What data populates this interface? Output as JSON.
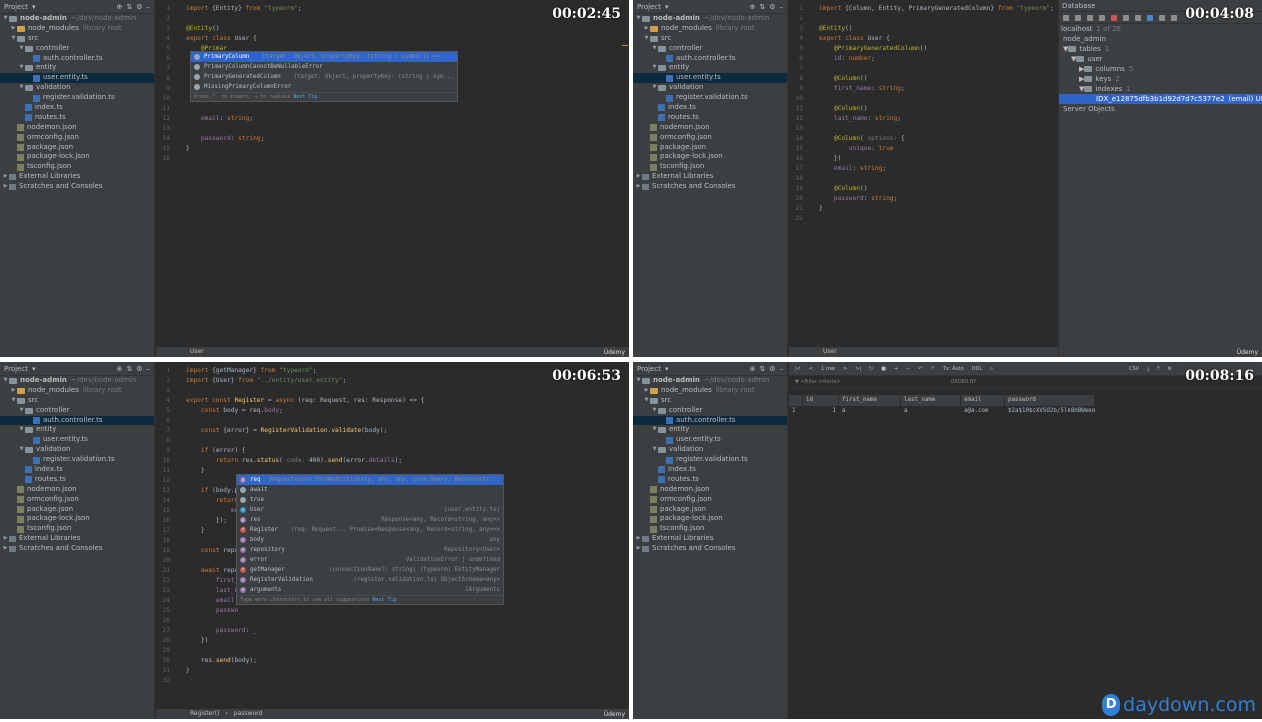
{
  "colors": {
    "keyword": "#cc7832",
    "string": "#6a8759",
    "annotation": "#bbb529",
    "selection": "#2f65ca",
    "watermark": "#2f7fd6"
  },
  "tree_common": {
    "header": "Project",
    "root": "node-admin",
    "root_path": "~/dev/node-admin",
    "node_modules": "node_modules",
    "node_modules_note": "library root",
    "src": "src",
    "controller": "controller",
    "auth_controller": "auth.controller.ts",
    "entity": "entity",
    "user_entity": "user.entity.ts",
    "validation": "validation",
    "register_validation": "register.validation.ts",
    "index": "index.ts",
    "routes": "routes.ts",
    "nodemon": "nodemon.json",
    "ormconfig": "ormconfig.json",
    "package": "package.json",
    "package_lock": "package-lock.json",
    "tsconfig": "tsconfig.json",
    "external": "External Libraries",
    "scratches": "Scratches and Consoles"
  },
  "q1": {
    "timer": "00:02:45",
    "status": "User",
    "brand": "Üdemy",
    "lines": [
      {
        "n": "1",
        "t": [
          [
            "kw",
            "import "
          ],
          [
            "plain",
            "{Entity} "
          ],
          [
            "kw",
            "from "
          ],
          [
            "str",
            "\"typeorm\""
          ],
          [
            "plain",
            ";"
          ]
        ]
      },
      {
        "n": "2",
        "t": []
      },
      {
        "n": "3",
        "t": [
          [
            "ann",
            "@Entity"
          ],
          [
            "plain",
            "()"
          ]
        ]
      },
      {
        "n": "4",
        "t": [
          [
            "kw",
            "export class "
          ],
          [
            "plain",
            "User {"
          ]
        ]
      },
      {
        "n": "5",
        "t": [
          [
            "plain",
            "    "
          ],
          [
            "ann",
            "@Primar"
          ]
        ]
      },
      {
        "n": "6",
        "t": []
      },
      {
        "n": "7",
        "t": []
      },
      {
        "n": "8",
        "t": []
      },
      {
        "n": "9",
        "t": []
      },
      {
        "n": "10",
        "t": []
      },
      {
        "n": "11",
        "t": []
      },
      {
        "n": "12",
        "t": [
          [
            "plain",
            "    "
          ],
          [
            "prop",
            "email"
          ],
          [
            "plain",
            ": "
          ],
          [
            "kw",
            "string"
          ],
          [
            "plain",
            ";"
          ]
        ]
      },
      {
        "n": "13",
        "t": []
      },
      {
        "n": "14",
        "t": [
          [
            "plain",
            "    "
          ],
          [
            "prop",
            "password"
          ],
          [
            "plain",
            ": "
          ],
          [
            "kw",
            "string"
          ],
          [
            "plain",
            ";"
          ]
        ]
      },
      {
        "n": "15",
        "t": [
          [
            "plain",
            "}"
          ]
        ]
      },
      {
        "n": "16",
        "t": []
      }
    ],
    "popup": {
      "items": [
        {
          "label": "PrimaryColumn",
          "right": "(target: Object, propertyKey: (string | symbol)) => ...",
          "sel": true
        },
        {
          "label": "PrimaryColumnCannotBeNullableError",
          "right": "",
          "sel": false
        },
        {
          "label": "PrimaryGeneratedColumn",
          "right": "(target: Object, propertyKey: (string | sym...",
          "sel": false
        },
        {
          "label": "MissingPrimaryColumnError",
          "right": "",
          "sel": false
        }
      ],
      "foot": "Press ^. to insert, → to replace",
      "tip": "Next Tip"
    }
  },
  "q2": {
    "timer": "00:04:08",
    "status": "User",
    "brand": "Üdemy",
    "lines": [
      {
        "n": "1",
        "t": [
          [
            "kw",
            "import "
          ],
          [
            "plain",
            "{Column, Entity, PrimaryGeneratedColumn} "
          ],
          [
            "kw",
            "from "
          ],
          [
            "str",
            "\"typeorm\""
          ],
          [
            "plain",
            ";"
          ]
        ]
      },
      {
        "n": "2",
        "t": []
      },
      {
        "n": "3",
        "t": [
          [
            "ann",
            "@Entity"
          ],
          [
            "plain",
            "()"
          ]
        ]
      },
      {
        "n": "4",
        "t": [
          [
            "kw",
            "export class "
          ],
          [
            "plain",
            "User {"
          ]
        ]
      },
      {
        "n": "5",
        "t": [
          [
            "plain",
            "    "
          ],
          [
            "ann",
            "@PrimaryGeneratedColumn"
          ],
          [
            "plain",
            "()"
          ]
        ]
      },
      {
        "n": "6",
        "t": [
          [
            "plain",
            "    "
          ],
          [
            "prop",
            "id"
          ],
          [
            "plain",
            ": "
          ],
          [
            "kw",
            "number"
          ],
          [
            "plain",
            ";"
          ]
        ]
      },
      {
        "n": "7",
        "t": []
      },
      {
        "n": "8",
        "t": [
          [
            "plain",
            "    "
          ],
          [
            "ann",
            "@Column"
          ],
          [
            "plain",
            "()"
          ]
        ]
      },
      {
        "n": "9",
        "t": [
          [
            "plain",
            "    "
          ],
          [
            "prop",
            "first_name"
          ],
          [
            "plain",
            ": "
          ],
          [
            "kw",
            "string"
          ],
          [
            "plain",
            ";"
          ]
        ]
      },
      {
        "n": "10",
        "t": []
      },
      {
        "n": "11",
        "t": [
          [
            "plain",
            "    "
          ],
          [
            "ann",
            "@Column"
          ],
          [
            "plain",
            "()"
          ]
        ]
      },
      {
        "n": "12",
        "t": [
          [
            "plain",
            "    "
          ],
          [
            "prop",
            "last_name"
          ],
          [
            "plain",
            ": "
          ],
          [
            "kw",
            "string"
          ],
          [
            "plain",
            ";"
          ]
        ]
      },
      {
        "n": "13",
        "t": []
      },
      {
        "n": "14",
        "t": [
          [
            "plain",
            "    "
          ],
          [
            "ann",
            "@Column"
          ],
          [
            "plain",
            "( "
          ],
          [
            "hint",
            "options: "
          ],
          [
            "plain",
            "{"
          ]
        ]
      },
      {
        "n": "15",
        "t": [
          [
            "plain",
            "        "
          ],
          [
            "prop",
            "unique"
          ],
          [
            "plain",
            ": "
          ],
          [
            "kw",
            "true"
          ]
        ]
      },
      {
        "n": "16",
        "t": [
          [
            "plain",
            "    })"
          ]
        ]
      },
      {
        "n": "17",
        "t": [
          [
            "plain",
            "    "
          ],
          [
            "prop",
            "email"
          ],
          [
            "plain",
            ": "
          ],
          [
            "kw",
            "string"
          ],
          [
            "plain",
            ";"
          ]
        ]
      },
      {
        "n": "18",
        "t": []
      },
      {
        "n": "19",
        "t": [
          [
            "plain",
            "    "
          ],
          [
            "ann",
            "@Column"
          ],
          [
            "plain",
            "()"
          ]
        ]
      },
      {
        "n": "20",
        "t": [
          [
            "plain",
            "    "
          ],
          [
            "prop",
            "password"
          ],
          [
            "plain",
            ": "
          ],
          [
            "kw",
            "string"
          ],
          [
            "plain",
            ";"
          ]
        ]
      },
      {
        "n": "21",
        "t": [
          [
            "plain",
            "}"
          ]
        ]
      },
      {
        "n": "22",
        "t": []
      }
    ],
    "db": {
      "title": "Database",
      "host": "localhost",
      "host_note": "1 of 26",
      "schema": "node_admin",
      "tables": "tables",
      "tables_count": "1",
      "user": "user",
      "columns": "columns",
      "columns_count": "5",
      "keys": "keys",
      "keys_count": "2",
      "indexes": "indexes",
      "indexes_count": "1",
      "index_name": "IDX_e12875dfb3b1d92d7d7c5377e2",
      "index_desc": "(email) UNIQUE",
      "server_objects": "Server Objects"
    }
  },
  "q3": {
    "timer": "00:06:53",
    "status": "Register()",
    "status2": "password",
    "brand": "Üdemy",
    "lines": [
      {
        "n": "1",
        "t": [
          [
            "kw",
            "import "
          ],
          [
            "plain",
            "{getManager} "
          ],
          [
            "kw",
            "from "
          ],
          [
            "str",
            "\"typeorm\""
          ],
          [
            "plain",
            ";"
          ]
        ]
      },
      {
        "n": "2",
        "t": [
          [
            "kw",
            "import "
          ],
          [
            "plain",
            "{User} "
          ],
          [
            "kw",
            "from "
          ],
          [
            "str",
            "\"../entity/user.entity\""
          ],
          [
            "plain",
            ";"
          ]
        ]
      },
      {
        "n": "3",
        "t": []
      },
      {
        "n": "4",
        "t": [
          [
            "kw",
            "export const "
          ],
          [
            "fn",
            "Register"
          ],
          [
            "plain",
            " = "
          ],
          [
            "kw",
            "async "
          ],
          [
            "plain",
            "(req: Request, res: Response) => {"
          ]
        ]
      },
      {
        "n": "5",
        "t": [
          [
            "plain",
            "    "
          ],
          [
            "kw",
            "const "
          ],
          [
            "plain",
            "body = req."
          ],
          [
            "prop",
            "body"
          ],
          [
            "plain",
            ";"
          ]
        ]
      },
      {
        "n": "6",
        "t": []
      },
      {
        "n": "7",
        "t": [
          [
            "plain",
            "    "
          ],
          [
            "kw",
            "const "
          ],
          [
            "plain",
            "{error} = "
          ],
          [
            "fn",
            "RegisterValidation"
          ],
          [
            "plain",
            "."
          ],
          [
            "fn",
            "validate"
          ],
          [
            "plain",
            "(body);"
          ]
        ]
      },
      {
        "n": "8",
        "t": []
      },
      {
        "n": "9",
        "t": [
          [
            "plain",
            "    "
          ],
          [
            "kw",
            "if "
          ],
          [
            "plain",
            "(error) {"
          ]
        ]
      },
      {
        "n": "10",
        "t": [
          [
            "plain",
            "        "
          ],
          [
            "kw",
            "return "
          ],
          [
            "plain",
            "res."
          ],
          [
            "fn",
            "status"
          ],
          [
            "plain",
            "( "
          ],
          [
            "hint",
            "code: "
          ],
          [
            "plain",
            "400)."
          ],
          [
            "fn",
            "send"
          ],
          [
            "plain",
            "(error."
          ],
          [
            "prop",
            "details"
          ],
          [
            "plain",
            ");"
          ]
        ]
      },
      {
        "n": "11",
        "t": [
          [
            "plain",
            "    }"
          ]
        ]
      },
      {
        "n": "12",
        "t": []
      },
      {
        "n": "13",
        "t": [
          [
            "plain",
            "    "
          ],
          [
            "kw",
            "if "
          ],
          [
            "plain",
            "(body.p"
          ]
        ]
      },
      {
        "n": "14",
        "t": [
          [
            "plain",
            "        "
          ],
          [
            "kw",
            "return"
          ]
        ]
      },
      {
        "n": "15",
        "t": [
          [
            "plain",
            "            "
          ],
          [
            "prop",
            "me"
          ]
        ]
      },
      {
        "n": "16",
        "t": [
          [
            "plain",
            "        });"
          ]
        ]
      },
      {
        "n": "17",
        "t": [
          [
            "plain",
            "    }"
          ]
        ]
      },
      {
        "n": "18",
        "t": []
      },
      {
        "n": "19",
        "t": [
          [
            "plain",
            "    "
          ],
          [
            "kw",
            "const "
          ],
          [
            "plain",
            "repo"
          ]
        ]
      },
      {
        "n": "20",
        "t": []
      },
      {
        "n": "21",
        "t": [
          [
            "plain",
            "    "
          ],
          [
            "kw",
            "await "
          ],
          [
            "plain",
            "repo"
          ]
        ]
      },
      {
        "n": "22",
        "t": [
          [
            "plain",
            "        "
          ],
          [
            "prop",
            "first_"
          ]
        ]
      },
      {
        "n": "23",
        "t": [
          [
            "plain",
            "        "
          ],
          [
            "prop",
            "last_n"
          ]
        ]
      },
      {
        "n": "24",
        "t": [
          [
            "plain",
            "        "
          ],
          [
            "prop",
            "email"
          ],
          [
            "plain",
            ":"
          ]
        ]
      },
      {
        "n": "25",
        "t": [
          [
            "plain",
            "        "
          ],
          [
            "prop",
            "passwo"
          ]
        ]
      },
      {
        "n": "26",
        "t": []
      },
      {
        "n": "27",
        "t": [
          [
            "plain",
            "        "
          ],
          [
            "prop",
            "password"
          ],
          [
            "plain",
            ": _"
          ]
        ]
      },
      {
        "n": "28",
        "t": [
          [
            "plain",
            "    })"
          ]
        ]
      },
      {
        "n": "29",
        "t": []
      },
      {
        "n": "30",
        "t": [
          [
            "plain",
            "    res."
          ],
          [
            "fn",
            "send"
          ],
          [
            "plain",
            "(body);"
          ]
        ]
      },
      {
        "n": "31",
        "t": [
          [
            "plain",
            "}"
          ]
        ]
      },
      {
        "n": "32",
        "t": []
      }
    ],
    "popup": {
      "items": [
        {
          "label": "req",
          "right": "Request<core.ParamsDictionary, any, any, core.Query, Record<str...",
          "sel": true,
          "ico": "p",
          "col": "#9876aa"
        },
        {
          "label": "await",
          "right": "",
          "sel": false,
          "ico": "",
          "col": ""
        },
        {
          "label": "true",
          "right": "",
          "sel": false,
          "ico": "",
          "col": ""
        },
        {
          "label": "User",
          "right": "(user.entity.ts)",
          "sel": false,
          "ico": "c",
          "col": "#3592c4"
        },
        {
          "label": "res",
          "right": "Response<any, Record<string, any>>",
          "sel": false,
          "ico": "p",
          "col": "#9876aa"
        },
        {
          "label": "Register",
          "right": "(req: Request... Promise<Response<any, Record<string, any>>>",
          "sel": false,
          "ico": "f",
          "col": "#c75450"
        },
        {
          "label": "body",
          "right": "any",
          "sel": false,
          "ico": "v",
          "col": "#9876aa"
        },
        {
          "label": "repository",
          "right": "Repository<User>",
          "sel": false,
          "ico": "v",
          "col": "#9876aa"
        },
        {
          "label": "error",
          "right": "ValidationError | undefined",
          "sel": false,
          "ico": "v",
          "col": "#9876aa"
        },
        {
          "label": "getManager",
          "right": "(connectionName?: string) (typeorm) EntityManager",
          "sel": false,
          "ico": "f",
          "col": "#c75450"
        },
        {
          "label": "RegisterValidation",
          "right": "(register.validation.ts) ObjectSchema<any>",
          "sel": false,
          "ico": "v",
          "col": "#9876aa"
        },
        {
          "label": "arguments",
          "right": "IArguments",
          "sel": false,
          "ico": "v",
          "col": "#9876aa"
        }
      ],
      "foot": "Type more characters to see all suggestions",
      "tip": "Next Tip"
    }
  },
  "q4": {
    "timer": "00:08:16",
    "toolbar": {
      "rows": "1 row",
      "tx": "Tx: Auto",
      "ddl": "DDL",
      "csv": "CSV"
    },
    "filter_where": "<Filter criteria>",
    "filter_order": "ORDER BY",
    "columns": [
      "id",
      "first_name",
      "last_name",
      "email",
      "password"
    ],
    "rows": [
      [
        "1",
        "1",
        "a",
        "a",
        "a@a.com",
        "$2a$10$cXVSO2b/5lk8hBWeeoZ..."
      ]
    ]
  },
  "watermark": "daydown.com"
}
